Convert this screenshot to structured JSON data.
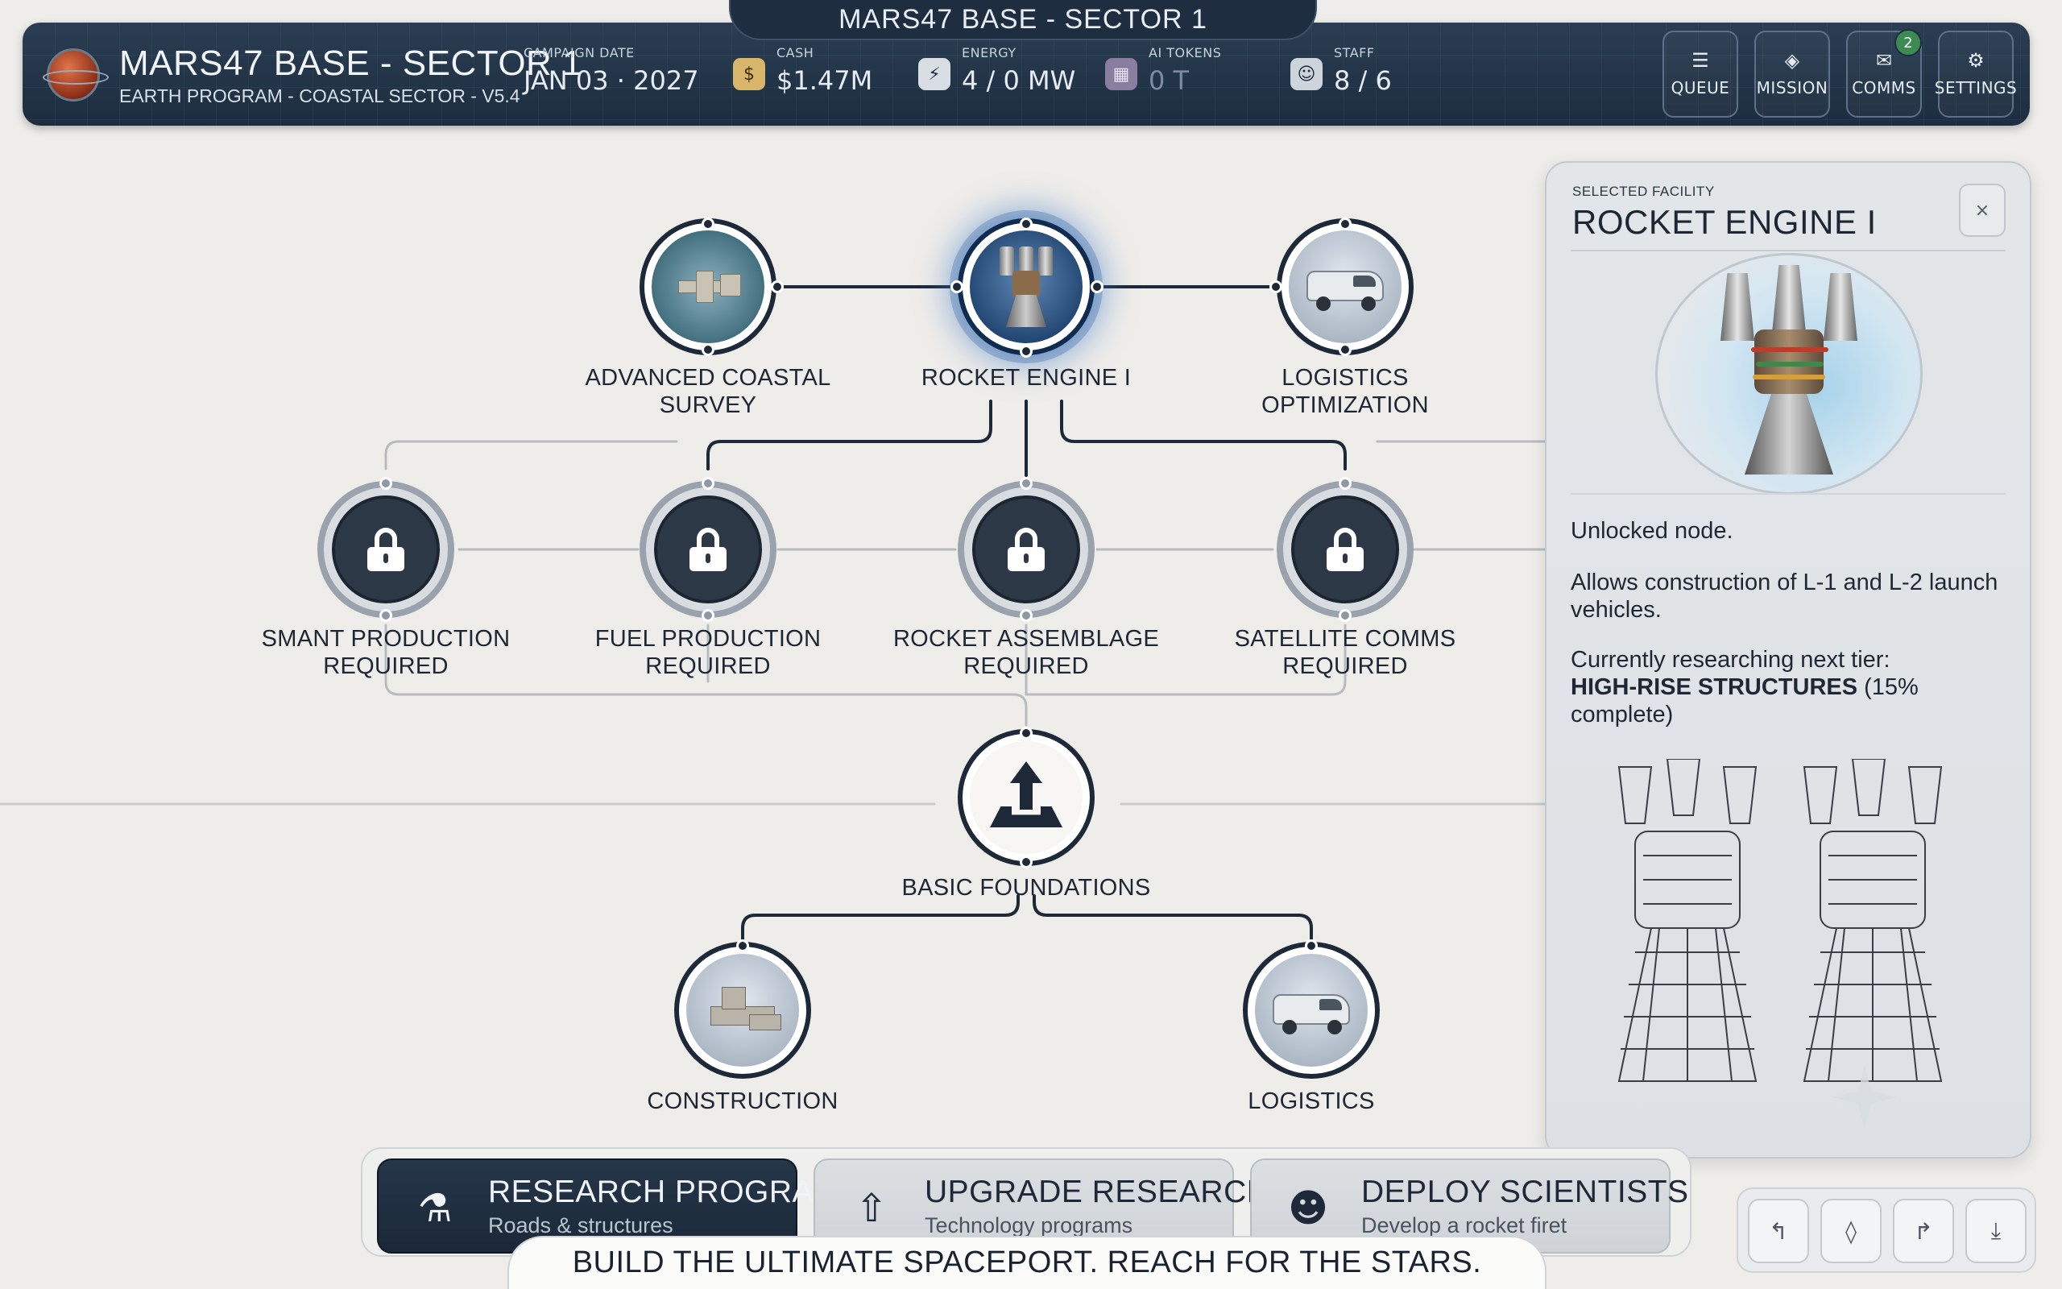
{
  "top_tab": {
    "title": "MARS47 BASE - SECTOR 1"
  },
  "header": {
    "base_title": "MARS47 BASE - SECTOR 1",
    "base_subtitle": "EARTH PROGRAM - COASTAL SECTOR - V5.4",
    "campaign": {
      "label": "CAMPAIGN DATE",
      "value": "JAN 03  ·  2027"
    },
    "cash": {
      "label": "CASH",
      "value": "$1.47M",
      "icon": "dollar-icon"
    },
    "energy": {
      "label": "ENERGY",
      "value": "4 / 0 MW",
      "icon": "lightning-icon"
    },
    "ai_tokens": {
      "label": "AI TOKENS",
      "value": "0 T",
      "icon": "chip-icon"
    },
    "staff": {
      "label": "STAFF",
      "value": "8 / 6",
      "icon": "people-icon"
    },
    "buttons": [
      {
        "label": "QUEUE",
        "icon": "list-icon"
      },
      {
        "label": "MISSION",
        "icon": "diamond-icon"
      },
      {
        "label": "COMMS",
        "icon": "mail-icon",
        "badge": "2"
      },
      {
        "label": "SETTINGS",
        "icon": "gear-icon"
      }
    ]
  },
  "tree": {
    "tier1": [
      {
        "label_line1": "ADVANCED COASTAL",
        "label_line2": "SURVEY",
        "state": "unlocked"
      },
      {
        "label_line1": "ROCKET ENGINE I",
        "label_line2": "",
        "state": "selected"
      },
      {
        "label_line1": "LOGISTICS",
        "label_line2": "OPTIMIZATION",
        "state": "unlocked"
      }
    ],
    "tier2": [
      {
        "label_line1": "SMANT PRODUCTION",
        "label_line2": "REQUIRED",
        "state": "locked"
      },
      {
        "label_line1": "FUEL PRODUCTION",
        "label_line2": "REQUIRED",
        "state": "locked"
      },
      {
        "label_line1": "ROCKET ASSEMBLAGE",
        "label_line2": "REQUIRED",
        "state": "locked"
      },
      {
        "label_line1": "SATELLITE COMMS",
        "label_line2": "REQUIRED",
        "state": "locked"
      }
    ],
    "foundation": {
      "label": "BASIC FOUNDATIONS"
    },
    "tier0": [
      {
        "label": "CONSTRUCTION"
      },
      {
        "label": "LOGISTICS"
      }
    ]
  },
  "panel": {
    "kicker": "SELECTED FACILITY",
    "title": "ROCKET ENGINE I",
    "close": "×",
    "status": "Unlocked node.",
    "description": "Allows construction of L-1 and L-2 launch vehicles.",
    "researching_prefix": "Currently researching next tier:",
    "researching_name": "HIGH-RISE STRUCTURES",
    "researching_progress": "(15% complete)"
  },
  "bottom": {
    "buttons": [
      {
        "title": "RESEARCH PROGRAMS",
        "subtitle": "Roads & structures",
        "icon": "flask-icon",
        "active": true
      },
      {
        "title": "UPGRADE RESEARCH",
        "subtitle": "Technology programs",
        "icon": "arrow-up-icon",
        "active": false
      },
      {
        "title": "DEPLOY SCIENTISTS",
        "subtitle": "Develop a rocket firet",
        "icon": "scientist-icon",
        "active": false
      }
    ],
    "tagline": "BUILD THE ULTIMATE SPACEPORT. REACH FOR THE STARS."
  },
  "tools": [
    {
      "icon": "undo-icon",
      "glyph": "↰"
    },
    {
      "icon": "drop-icon",
      "glyph": "◊"
    },
    {
      "icon": "redo-icon",
      "glyph": "↱"
    },
    {
      "icon": "download-icon",
      "glyph": "⤓"
    }
  ]
}
